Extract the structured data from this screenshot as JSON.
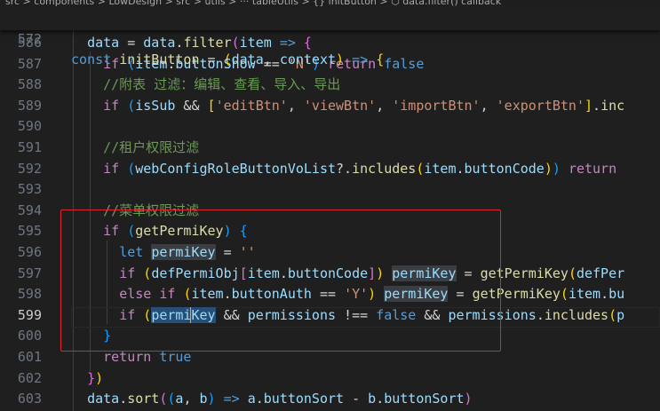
{
  "breadcrumb": "src > components > LowDesign > src > utils > ··· tableUtils > {} initButton > ⬡ data.filter() callback",
  "sticky_line": {
    "number": "572",
    "tokens": [
      [
        "kw",
        "const "
      ],
      [
        "fn",
        "initButton"
      ],
      [
        "txt",
        " = "
      ],
      [
        "b1",
        "("
      ],
      [
        "var",
        "data"
      ],
      [
        "txt",
        ", "
      ],
      [
        "var",
        "context"
      ],
      [
        "b1",
        ")"
      ],
      [
        "txt",
        " "
      ],
      [
        "kw",
        "=>"
      ],
      [
        "txt",
        " "
      ],
      [
        "b1",
        "{"
      ]
    ]
  },
  "active_line": "599",
  "lines": [
    {
      "number": "586",
      "tokens": [
        [
          "txt",
          "  "
        ],
        [
          "var",
          "data"
        ],
        [
          "txt",
          " = "
        ],
        [
          "var",
          "data"
        ],
        [
          "txt",
          "."
        ],
        [
          "fn",
          "filter"
        ],
        [
          "b2",
          "("
        ],
        [
          "var",
          "item"
        ],
        [
          "txt",
          " "
        ],
        [
          "kw",
          "=>"
        ],
        [
          "txt",
          " "
        ],
        [
          "b2",
          "{"
        ]
      ]
    },
    {
      "number": "587",
      "tokens": [
        [
          "txt",
          "    "
        ],
        [
          "ctl",
          "if"
        ],
        [
          "txt",
          " "
        ],
        [
          "b3",
          "("
        ],
        [
          "var",
          "item"
        ],
        [
          "txt",
          "."
        ],
        [
          "var",
          "buttonShow"
        ],
        [
          "txt",
          " == "
        ],
        [
          "str",
          "'N'"
        ],
        [
          "b3",
          ")"
        ],
        [
          "txt",
          " "
        ],
        [
          "ctl",
          "return"
        ],
        [
          "txt",
          " "
        ],
        [
          "kw",
          "false"
        ]
      ]
    },
    {
      "number": "588",
      "tokens": [
        [
          "txt",
          "    "
        ],
        [
          "cmt",
          "//附表 过滤：编辑、查看、导入、导出"
        ]
      ]
    },
    {
      "number": "589",
      "tokens": [
        [
          "txt",
          "    "
        ],
        [
          "ctl",
          "if"
        ],
        [
          "txt",
          " "
        ],
        [
          "b3",
          "("
        ],
        [
          "var",
          "isSub"
        ],
        [
          "txt",
          " && "
        ],
        [
          "b1",
          "["
        ],
        [
          "str",
          "'editBtn'"
        ],
        [
          "txt",
          ", "
        ],
        [
          "str",
          "'viewBtn'"
        ],
        [
          "txt",
          ", "
        ],
        [
          "str",
          "'importBtn'"
        ],
        [
          "txt",
          ", "
        ],
        [
          "str",
          "'exportBtn'"
        ],
        [
          "b1",
          "]"
        ],
        [
          "txt",
          "."
        ],
        [
          "fn",
          "inc"
        ]
      ]
    },
    {
      "number": "590",
      "tokens": []
    },
    {
      "number": "591",
      "tokens": [
        [
          "txt",
          "    "
        ],
        [
          "cmt",
          "//租户权限过滤"
        ]
      ]
    },
    {
      "number": "592",
      "tokens": [
        [
          "txt",
          "    "
        ],
        [
          "ctl",
          "if"
        ],
        [
          "txt",
          " "
        ],
        [
          "b3",
          "("
        ],
        [
          "var",
          "webConfigRoleButtonVoList"
        ],
        [
          "txt",
          "?."
        ],
        [
          "fn",
          "includes"
        ],
        [
          "b1",
          "("
        ],
        [
          "var",
          "item"
        ],
        [
          "txt",
          "."
        ],
        [
          "var",
          "buttonCode"
        ],
        [
          "b1",
          ")"
        ],
        [
          "b3",
          ")"
        ],
        [
          "txt",
          " "
        ],
        [
          "ctl",
          "return"
        ]
      ]
    },
    {
      "number": "593",
      "tokens": []
    },
    {
      "number": "594",
      "tokens": [
        [
          "txt",
          "    "
        ],
        [
          "cmt",
          "//菜单权限过滤"
        ]
      ]
    },
    {
      "number": "595",
      "tokens": [
        [
          "txt",
          "    "
        ],
        [
          "ctl",
          "if"
        ],
        [
          "txt",
          " "
        ],
        [
          "b3",
          "("
        ],
        [
          "fn",
          "getPermiKey"
        ],
        [
          "b3",
          ")"
        ],
        [
          "txt",
          " "
        ],
        [
          "b3",
          "{"
        ]
      ]
    },
    {
      "number": "596",
      "tokens": [
        [
          "txt",
          "      "
        ],
        [
          "kw",
          "let"
        ],
        [
          "txt",
          " "
        ],
        [
          "var",
          "permiKey",
          "hl2"
        ],
        [
          "txt",
          " = "
        ],
        [
          "str",
          "''"
        ]
      ]
    },
    {
      "number": "597",
      "tokens": [
        [
          "txt",
          "      "
        ],
        [
          "ctl",
          "if"
        ],
        [
          "txt",
          " "
        ],
        [
          "b1",
          "("
        ],
        [
          "var",
          "defPermiObj"
        ],
        [
          "b2",
          "["
        ],
        [
          "var",
          "item"
        ],
        [
          "txt",
          "."
        ],
        [
          "var",
          "buttonCode"
        ],
        [
          "b2",
          "]"
        ],
        [
          "b1",
          ")"
        ],
        [
          "txt",
          " "
        ],
        [
          "var",
          "permiKey",
          "hl2"
        ],
        [
          "txt",
          " = "
        ],
        [
          "fn",
          "getPermiKey"
        ],
        [
          "b1",
          "("
        ],
        [
          "var",
          "defPer"
        ]
      ]
    },
    {
      "number": "598",
      "tokens": [
        [
          "txt",
          "      "
        ],
        [
          "ctl",
          "else"
        ],
        [
          "txt",
          " "
        ],
        [
          "ctl",
          "if"
        ],
        [
          "txt",
          " "
        ],
        [
          "b1",
          "("
        ],
        [
          "var",
          "item"
        ],
        [
          "txt",
          "."
        ],
        [
          "var",
          "buttonAuth"
        ],
        [
          "txt",
          " == "
        ],
        [
          "str",
          "'Y'"
        ],
        [
          "b1",
          ")"
        ],
        [
          "txt",
          " "
        ],
        [
          "var",
          "permiKey",
          "hl2"
        ],
        [
          "txt",
          " = "
        ],
        [
          "fn",
          "getPermiKey"
        ],
        [
          "b1",
          "("
        ],
        [
          "var",
          "item"
        ],
        [
          "txt",
          "."
        ],
        [
          "var",
          "bu"
        ]
      ]
    },
    {
      "number": "599",
      "tokens": [
        [
          "txt",
          "      "
        ],
        [
          "ctl",
          "if"
        ],
        [
          "txt",
          " "
        ],
        [
          "b1",
          "("
        ],
        [
          "var",
          "permi",
          "hl"
        ],
        [
          "cursor",
          ""
        ],
        [
          "var",
          "Key",
          "hl"
        ],
        [
          "txt",
          " && "
        ],
        [
          "var",
          "permissions"
        ],
        [
          "txt",
          " !== "
        ],
        [
          "kw",
          "false"
        ],
        [
          "txt",
          " && "
        ],
        [
          "var",
          "permissions"
        ],
        [
          "txt",
          "."
        ],
        [
          "fn",
          "includes"
        ],
        [
          "b1",
          "("
        ],
        [
          "var",
          "p"
        ]
      ]
    },
    {
      "number": "600",
      "tokens": [
        [
          "txt",
          "    "
        ],
        [
          "b3",
          "}"
        ]
      ]
    },
    {
      "number": "601",
      "tokens": [
        [
          "txt",
          "    "
        ],
        [
          "ctl",
          "return"
        ],
        [
          "txt",
          " "
        ],
        [
          "kw",
          "true"
        ]
      ]
    },
    {
      "number": "602",
      "tokens": [
        [
          "txt",
          "  "
        ],
        [
          "b2",
          "}"
        ],
        [
          "b1",
          ")"
        ]
      ]
    },
    {
      "number": "603",
      "tokens": [
        [
          "txt",
          "  "
        ],
        [
          "var",
          "data"
        ],
        [
          "txt",
          "."
        ],
        [
          "fn",
          "sort"
        ],
        [
          "b2",
          "("
        ],
        [
          "b3",
          "("
        ],
        [
          "var",
          "a"
        ],
        [
          "txt",
          ", "
        ],
        [
          "var",
          "b"
        ],
        [
          "b3",
          ")"
        ],
        [
          "txt",
          " "
        ],
        [
          "kw",
          "=>"
        ],
        [
          "txt",
          " "
        ],
        [
          "var",
          "a"
        ],
        [
          "txt",
          "."
        ],
        [
          "var",
          "buttonSort"
        ],
        [
          "txt",
          " - "
        ],
        [
          "var",
          "b"
        ],
        [
          "txt",
          "."
        ],
        [
          "var",
          "buttonSort"
        ],
        [
          "b2",
          ")"
        ]
      ]
    }
  ],
  "colors": {
    "background": "#1f1f1f",
    "annotation_box": "#e0242d",
    "selection": "#264f78"
  }
}
